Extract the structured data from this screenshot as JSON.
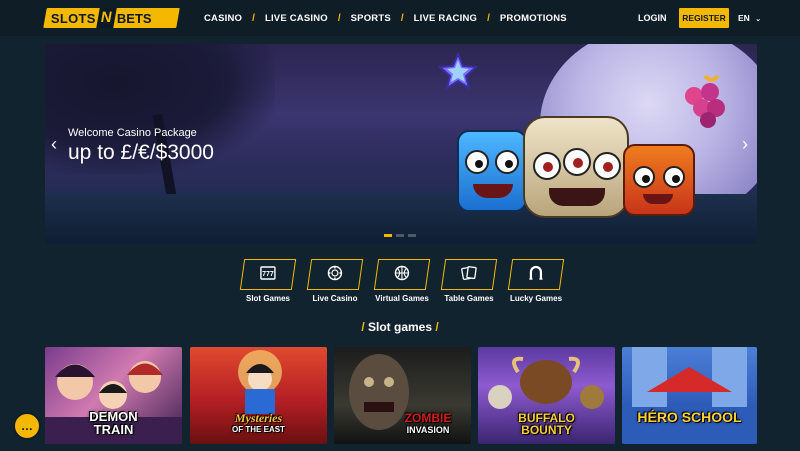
{
  "header": {
    "logo_part1": "SLOTS",
    "logo_n": "N",
    "logo_part2": "BETS",
    "nav": [
      "CASINO",
      "LIVE CASINO",
      "SPORTS",
      "LIVE RACING",
      "PROMOTIONS"
    ],
    "login": "LOGIN",
    "register": "REGISTER",
    "lang": "EN"
  },
  "banner": {
    "subtitle": "Welcome Casino Package",
    "title": "up to £/€/$3000",
    "slide_count": 3,
    "active_slide": 1
  },
  "categories": [
    {
      "label": "Slot Games",
      "icon": "slot-machine-icon"
    },
    {
      "label": "Live Casino",
      "icon": "casino-chip-icon"
    },
    {
      "label": "Virtual Games",
      "icon": "basketball-icon"
    },
    {
      "label": "Table Games",
      "icon": "playing-cards-icon"
    },
    {
      "label": "Lucky Games",
      "icon": "horseshoe-icon"
    }
  ],
  "section": {
    "title": "Slot games"
  },
  "games": [
    {
      "line1": "DEMON",
      "line2": "TRAIN"
    },
    {
      "line1": "Mysteries",
      "line2": "OF THE EAST"
    },
    {
      "line1": "ZOMBIE",
      "line2": "INVASION"
    },
    {
      "line1": "BUFFALO",
      "line2": "BOUNTY"
    },
    {
      "line1": "HÉRO SCHOOL",
      "line2": ""
    }
  ],
  "colors": {
    "accent": "#f5b800",
    "background": "#122330",
    "header": "#0f1d27"
  }
}
